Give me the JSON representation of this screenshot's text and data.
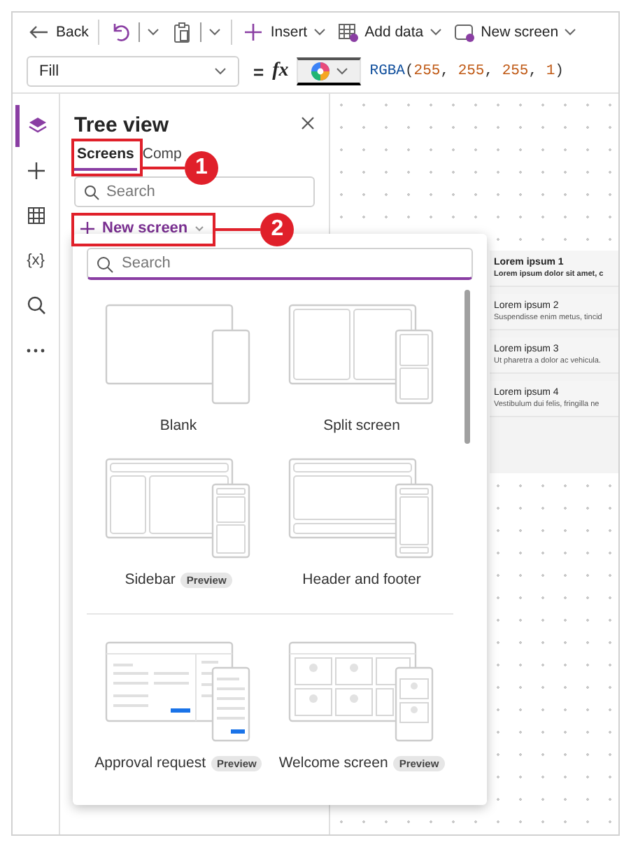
{
  "toolbar": [
    {
      "kind": "back",
      "label": "Back"
    },
    {
      "kind": "divider"
    },
    {
      "kind": "undo",
      "split": true
    },
    {
      "kind": "paste",
      "split": true
    },
    {
      "kind": "divider"
    },
    {
      "kind": "insert",
      "label": "Insert",
      "chevron": true
    },
    {
      "kind": "add-data",
      "label": "Add data",
      "chevron": true
    },
    {
      "kind": "new-screen",
      "label": "New screen",
      "chevron": true
    }
  ],
  "formula_bar": {
    "property": "Fill",
    "equals": "=",
    "fx": "fx",
    "formula": [
      {
        "kind": "function",
        "text": "RGBA"
      },
      {
        "kind": "punct",
        "text": "("
      },
      {
        "kind": "number",
        "text": "255"
      },
      {
        "kind": "punct",
        "text": ", "
      },
      {
        "kind": "number",
        "text": "255"
      },
      {
        "kind": "punct",
        "text": ", "
      },
      {
        "kind": "number",
        "text": "255"
      },
      {
        "kind": "punct",
        "text": ", "
      },
      {
        "kind": "number",
        "text": "1"
      },
      {
        "kind": "punct",
        "text": ")"
      }
    ]
  },
  "rail": [
    {
      "kind": "layers",
      "selected": true
    },
    {
      "kind": "plus",
      "selected": false
    },
    {
      "kind": "table",
      "selected": false
    },
    {
      "kind": "variables",
      "glyph": "{x}",
      "selected": false
    },
    {
      "kind": "search",
      "selected": false
    },
    {
      "kind": "more",
      "selected": false
    }
  ],
  "tree_view": {
    "title": "Tree view",
    "tabs": [
      {
        "label": "Screens",
        "selected": true
      },
      {
        "label": "Comp",
        "selected": false
      }
    ],
    "search": {
      "placeholder": "Search"
    },
    "new_screen": {
      "label": "New screen"
    }
  },
  "callouts": [
    {
      "number": "1"
    },
    {
      "number": "2"
    }
  ],
  "new_screen_menu": {
    "search": {
      "placeholder": "Search"
    },
    "templates": [
      {
        "kind": "blank",
        "label": "Blank"
      },
      {
        "kind": "split",
        "label": "Split screen"
      },
      {
        "kind": "sidebar",
        "label": "Sidebar",
        "badge": "Preview"
      },
      {
        "kind": "header-footer",
        "label": "Header and footer"
      },
      {
        "kind": "approval",
        "label": "Approval request",
        "badge": "Preview"
      },
      {
        "kind": "welcome",
        "label": "Welcome screen",
        "badge": "Preview"
      }
    ]
  },
  "canvas_list": [
    {
      "title": "Lorem ipsum 1",
      "subtitle": "Lorem ipsum dolor sit amet, c",
      "selected": true
    },
    {
      "title": "Lorem ipsum 2",
      "subtitle": "Suspendisse enim metus, tincid",
      "selected": false
    },
    {
      "title": "Lorem ipsum 3",
      "subtitle": "Ut pharetra a dolor ac vehicula.",
      "selected": false
    },
    {
      "title": "Lorem ipsum 4",
      "subtitle": "Vestibulum dui felis, fringilla ne",
      "selected": false
    }
  ]
}
